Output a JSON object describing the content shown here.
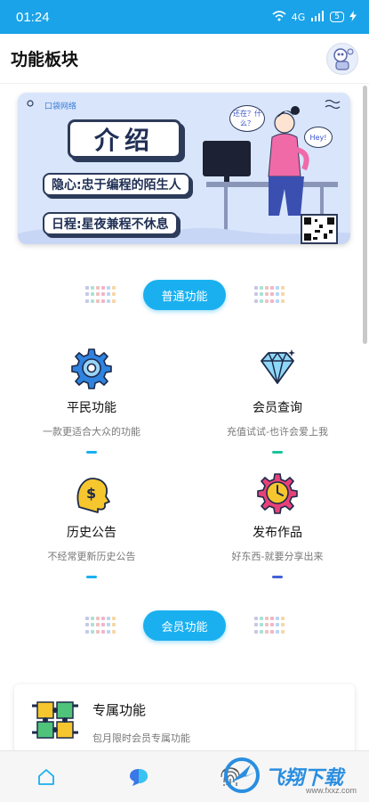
{
  "status_bar": {
    "time": "01:24",
    "network": "4G",
    "battery": "5"
  },
  "header": {
    "title": "功能板块"
  },
  "banner": {
    "brand": "口袋网络",
    "headline": "介绍",
    "line1": "隐心:忠于编程的陌生人",
    "line2": "日程:星夜兼程不休息",
    "bubble1": "还在？什么？",
    "bubble2": "Hey!"
  },
  "sections": {
    "normal": "普通功能",
    "member": "会员功能"
  },
  "cards": [
    {
      "name": "平民功能",
      "desc": "一款更适合大众的功能",
      "icon": "gear-icon",
      "accent": "#1ab0f0"
    },
    {
      "name": "会员查询",
      "desc": "充值试试-也许会爱上我",
      "icon": "diamond-icon",
      "accent": "#19c39a"
    },
    {
      "name": "历史公告",
      "desc": "不经常更新历史公告",
      "icon": "head-money-icon",
      "accent": "#1ab0f0"
    },
    {
      "name": "发布作品",
      "desc": "好东西-就要分享出来",
      "icon": "gear-clock-icon",
      "accent": "#4360d6"
    }
  ],
  "exclusive": {
    "title": "专属功能",
    "desc": "包月限时会员专属功能"
  },
  "watermark": {
    "text": "飞翔下载",
    "url": "www.fxxz.com"
  },
  "colors": {
    "primary": "#1ab0f0",
    "status_bar": "#1aa3e8"
  }
}
